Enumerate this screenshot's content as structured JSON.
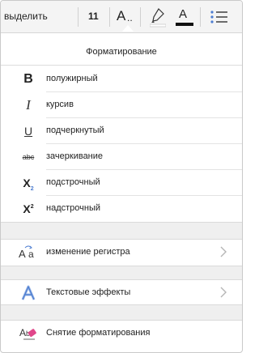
{
  "toolbar": {
    "select_label": "выделить",
    "font_size": "11",
    "font_size_tool_letter": "A",
    "font_size_tool_dots": "..",
    "font_color_letter": "A",
    "font_color_value": "#111111",
    "icons": [
      "highlighter-icon",
      "font-color-icon",
      "bullet-list-icon"
    ]
  },
  "panel": {
    "title": "Форматирование",
    "text_styles": [
      {
        "icon": "bold-icon",
        "icon_text": "B",
        "label": "полужирный"
      },
      {
        "icon": "italic-icon",
        "icon_text": "I",
        "label": "курсив"
      },
      {
        "icon": "underline-icon",
        "icon_text": "U",
        "label": "подчеркнутый"
      },
      {
        "icon": "strikethrough-icon",
        "icon_text": "abc",
        "label": "зачеркивание"
      },
      {
        "icon": "subscript-icon",
        "icon_text": "X",
        "icon_sub": "2",
        "label": "подстрочный"
      },
      {
        "icon": "superscript-icon",
        "icon_text": "X",
        "icon_sup": "2",
        "label": "надстрочный"
      }
    ],
    "change_case": {
      "icon": "change-case-icon",
      "label": "изменение регистра"
    },
    "text_effects": {
      "icon": "text-effects-icon",
      "label": "Текстовые эффекты",
      "accent": "#4a7bd0"
    },
    "clear_formatting": {
      "icon": "clear-formatting-icon",
      "label": "Снятие форматирования",
      "accent": "#e0478a"
    }
  }
}
